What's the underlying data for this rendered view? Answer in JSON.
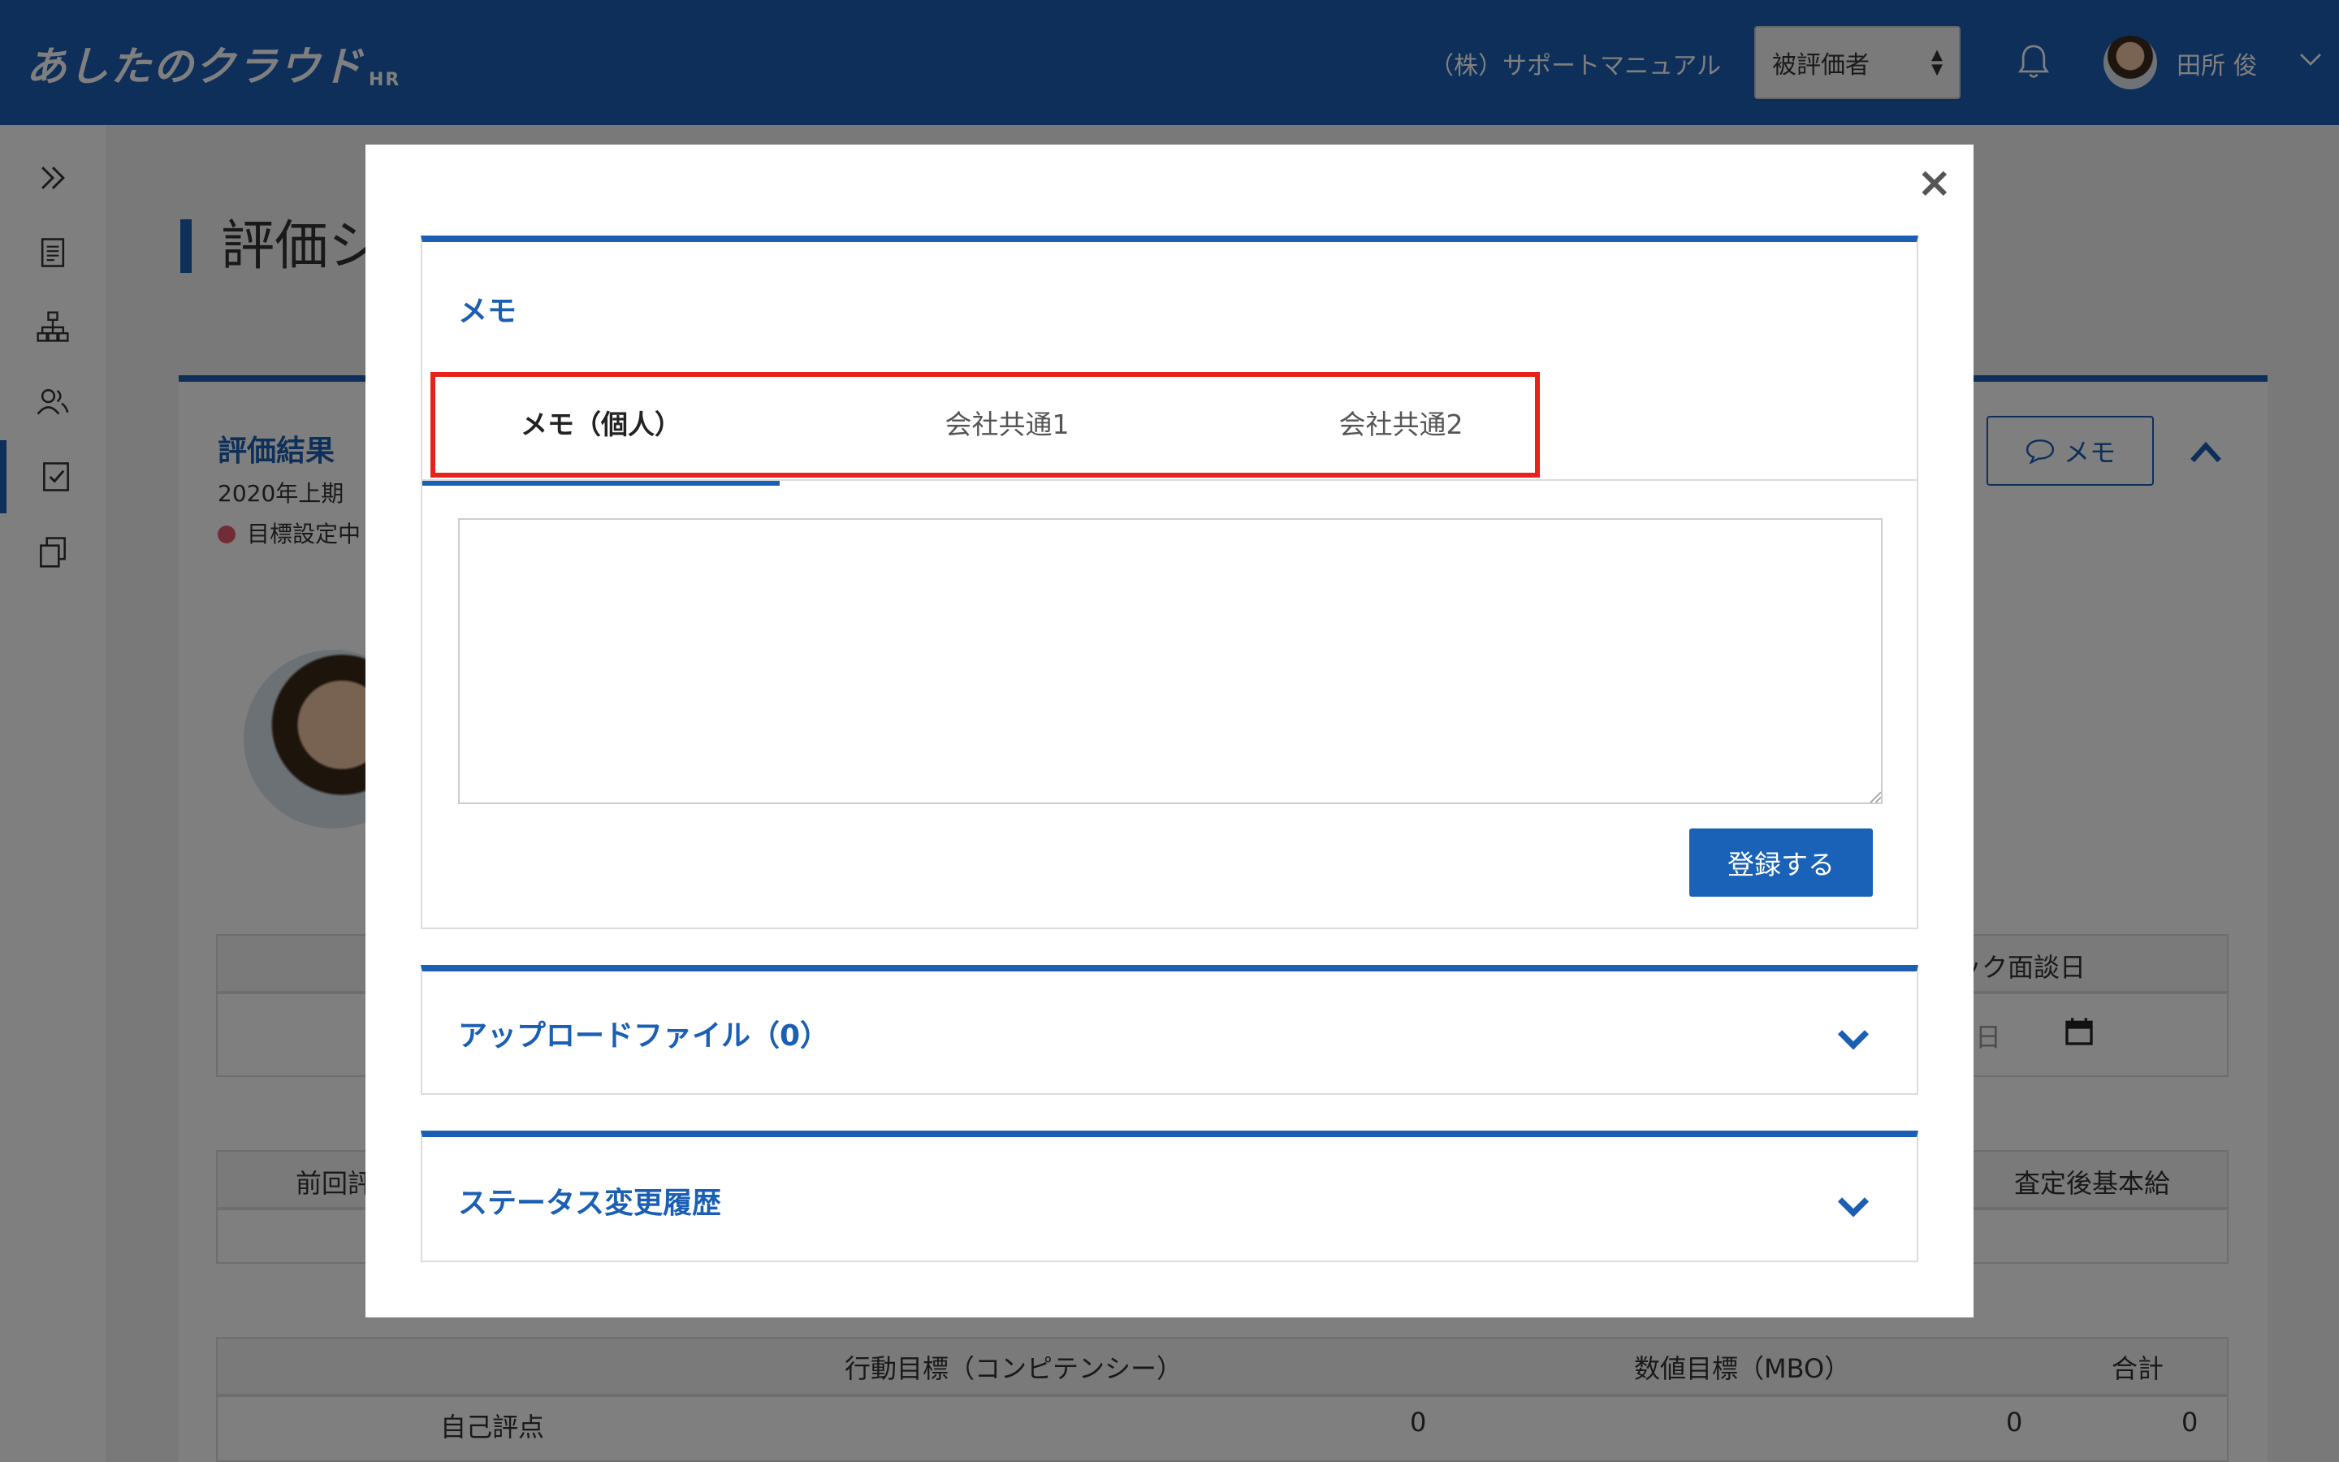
{
  "header": {
    "logo_text": "あしたのクラウド",
    "logo_sub": "HR",
    "company": "（株）サポートマニュアル",
    "role_select_value": "被評価者",
    "user_name": "田所 俊"
  },
  "sidebar": {
    "items": [
      {
        "icon": "expand-icon"
      },
      {
        "icon": "document-icon"
      },
      {
        "icon": "org-chart-icon"
      },
      {
        "icon": "users-icon"
      },
      {
        "icon": "checklist-icon",
        "active": true
      },
      {
        "icon": "copy-icon"
      }
    ]
  },
  "background": {
    "page_title": "評価シ",
    "result_title": "評価結果",
    "period": "2020年上期",
    "status": "目標設定中",
    "memo_button": "メモ",
    "meeting_date_header": "ック面談日",
    "date_placeholder_fragment": "日",
    "prev_label": "前回評",
    "salary_header": "査定後基本給",
    "score_table": {
      "headers": [
        "行動目標（コンピテンシー）",
        "数値目標（MBO）",
        "合計"
      ],
      "row_label": "自己評点",
      "values": [
        "0",
        "0",
        "0"
      ]
    }
  },
  "modal": {
    "memo_section": {
      "title": "メモ",
      "tabs": [
        {
          "label": "メモ（個人）",
          "active": true
        },
        {
          "label": "会社共通1",
          "active": false
        },
        {
          "label": "会社共通2",
          "active": false
        }
      ],
      "textarea_value": "",
      "submit_label": "登録する"
    },
    "upload_section": {
      "title": "アップロードファイル（0）"
    },
    "status_section": {
      "title": "ステータス変更履歴"
    }
  },
  "colors": {
    "brand": "#1a5fb4",
    "highlight": "#e8211b",
    "status_dot": "#e05a6a"
  }
}
